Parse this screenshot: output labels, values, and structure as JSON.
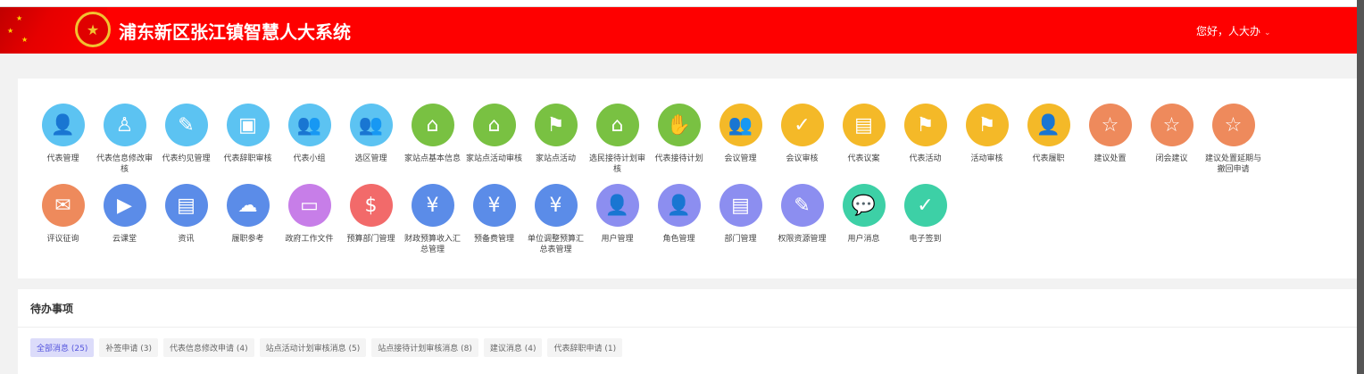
{
  "header": {
    "title": "浦东新区张江镇智慧人大系统",
    "greeting": "您好，人大办",
    "caret": "⌄"
  },
  "apps": [
    {
      "label": "代表管理",
      "color": "#5cc3f2",
      "icon": "👤"
    },
    {
      "label": "代表信息修改审核",
      "color": "#5cc3f2",
      "icon": "♙"
    },
    {
      "label": "代表约见管理",
      "color": "#5cc3f2",
      "icon": "✎"
    },
    {
      "label": "代表辞职审核",
      "color": "#5cc3f2",
      "icon": "▣"
    },
    {
      "label": "代表小组",
      "color": "#5cc3f2",
      "icon": "👥"
    },
    {
      "label": "选区管理",
      "color": "#5cc3f2",
      "icon": "👥"
    },
    {
      "label": "家站点基本信息",
      "color": "#79c142",
      "icon": "⌂"
    },
    {
      "label": "家站点活动审核",
      "color": "#79c142",
      "icon": "⌂"
    },
    {
      "label": "家站点活动",
      "color": "#79c142",
      "icon": "⚑"
    },
    {
      "label": "选民接待计划审核",
      "color": "#79c142",
      "icon": "⌂"
    },
    {
      "label": "代表接待计划",
      "color": "#79c142",
      "icon": "✋"
    },
    {
      "label": "会议管理",
      "color": "#f4b928",
      "icon": "👥"
    },
    {
      "label": "会议审核",
      "color": "#f4b928",
      "icon": "✓"
    },
    {
      "label": "代表议案",
      "color": "#f4b928",
      "icon": "▤"
    },
    {
      "label": "代表活动",
      "color": "#f4b928",
      "icon": "⚑"
    },
    {
      "label": "活动审核",
      "color": "#f4b928",
      "icon": "⚑"
    },
    {
      "label": "代表履职",
      "color": "#f4b928",
      "icon": "👤"
    },
    {
      "label": "建议处置",
      "color": "#ee8a5c",
      "icon": "☆"
    },
    {
      "label": "闭会建议",
      "color": "#ee8a5c",
      "icon": "☆"
    },
    {
      "label": "建议处置延期与撤回申请",
      "color": "#ee8a5c",
      "icon": "☆"
    },
    {
      "label": "评议征询",
      "color": "#ee8a5c",
      "icon": "✉"
    },
    {
      "label": "云课堂",
      "color": "#5b8ce8",
      "icon": "▶"
    },
    {
      "label": "资讯",
      "color": "#5b8ce8",
      "icon": "▤"
    },
    {
      "label": "履职参考",
      "color": "#5b8ce8",
      "icon": "☁"
    },
    {
      "label": "政府工作文件",
      "color": "#c77ee8",
      "icon": "▭"
    },
    {
      "label": "预算部门管理",
      "color": "#f26a6a",
      "icon": "$"
    },
    {
      "label": "财政预算收入汇总管理",
      "color": "#5b8ce8",
      "icon": "¥"
    },
    {
      "label": "预备费管理",
      "color": "#5b8ce8",
      "icon": "¥"
    },
    {
      "label": "单位调整预算汇总表管理",
      "color": "#5b8ce8",
      "icon": "¥"
    },
    {
      "label": "用户管理",
      "color": "#8c8ef0",
      "icon": "👤"
    },
    {
      "label": "角色管理",
      "color": "#8c8ef0",
      "icon": "👤"
    },
    {
      "label": "部门管理",
      "color": "#8c8ef0",
      "icon": "▤"
    },
    {
      "label": "权限资源管理",
      "color": "#8c8ef0",
      "icon": "✎"
    },
    {
      "label": "用户消息",
      "color": "#3dd0a6",
      "icon": "💬"
    },
    {
      "label": "电子签到",
      "color": "#3dd0a6",
      "icon": "✓"
    }
  ],
  "todo": {
    "title": "待办事项",
    "tabs": [
      "全部消息 (25)",
      "补签申请 (3)",
      "代表信息修改申请 (4)",
      "站点活动计划审核消息 (5)",
      "站点接待计划审核消息 (8)",
      "建议消息 (4)",
      "代表辞职申请 (1)"
    ],
    "active": 0
  }
}
